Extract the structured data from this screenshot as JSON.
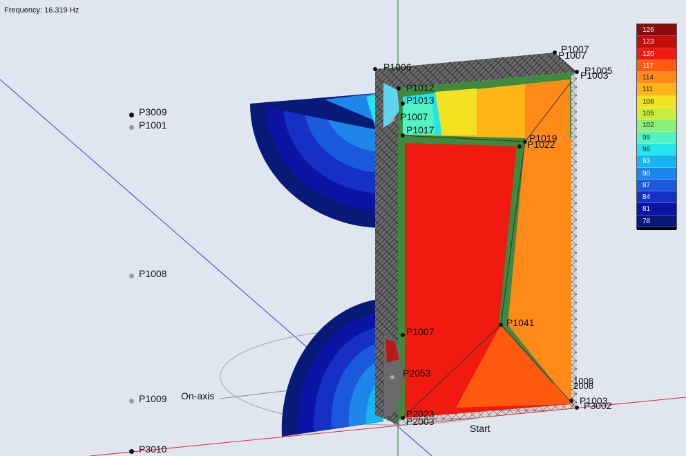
{
  "header": {
    "frequency_label": "Frequency: 16.319 Hz"
  },
  "colors": {
    "background": "#dfe6ef",
    "axis_x": "#e0262a",
    "axis_y": "#3b9a3b",
    "axis_z": "#2640d6",
    "mesh": "#5b5b5b",
    "cabinet_green": "#3e8a3e"
  },
  "legend": {
    "values": [
      "126",
      "123",
      "120",
      "117",
      "114",
      "111",
      "108",
      "105",
      "102",
      "99",
      "96",
      "93",
      "90",
      "87",
      "84",
      "81",
      "78"
    ],
    "colors": [
      "#8b0a0a",
      "#c30c0c",
      "#f01a10",
      "#ff5a10",
      "#ff8a18",
      "#ffb518",
      "#f3e222",
      "#c9ee3a",
      "#8af07a",
      "#52f2c2",
      "#22e5ee",
      "#18b4f0",
      "#1e86ea",
      "#1c58dc",
      "#1630c6",
      "#0c14a6",
      "#081a78"
    ]
  },
  "points": [
    {
      "label": "P3009",
      "dot": "black"
    },
    {
      "label": "P1001",
      "dot": "gray"
    },
    {
      "label": "P1008",
      "dot": "gray"
    },
    {
      "label": "P1009",
      "dot": "gray"
    },
    {
      "label": "P3010",
      "dot": "black"
    }
  ],
  "model_labels": {
    "p1006": "P1006",
    "p1007_top": "P1007",
    "p1007_top2": "P1007",
    "p1005": "P1005",
    "p1003_top": "P1003",
    "p1012": "P1012",
    "p1013": "P1013",
    "p1007_mid": "P1007",
    "p1017": "P1017",
    "p1019": "P1019",
    "p1022": "P1022",
    "p1007_low": "P1007",
    "p1041": "P1041",
    "p2053": "P2053",
    "p2023": "P2023",
    "p2003": "P2003",
    "p1003_bottom": "P1003",
    "p3002": "P3002",
    "p1008_right": "1008",
    "p2008_right": "2008",
    "on_axis": "On-axis",
    "start": "Start"
  }
}
